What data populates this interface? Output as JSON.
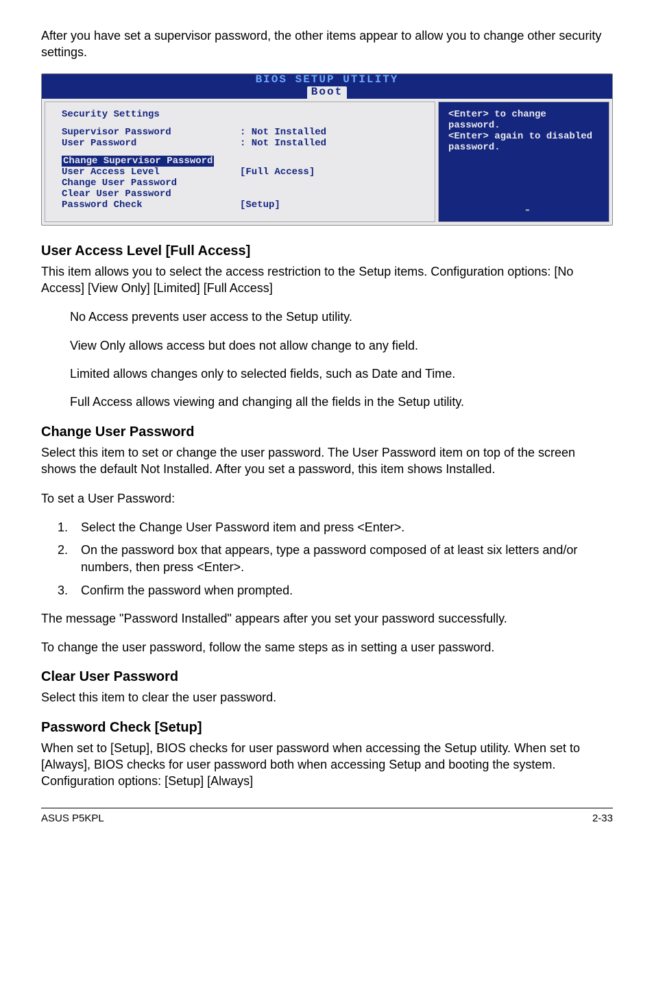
{
  "intro_paragraph": "After you have set a supervisor password, the other items appear to allow you to change other security settings.",
  "bios": {
    "title_top": "BIOS SETUP UTILITY",
    "tab": "Boot",
    "heading": "Security Settings",
    "rows": {
      "supervisor_label": "Supervisor Password",
      "supervisor_value": ": Not Installed",
      "user_label": "User Password",
      "user_value": ": Not Installed",
      "change_supervisor": "Change Supervisor Password",
      "user_access_label": "User Access Level",
      "user_access_value": "[Full Access]",
      "change_user": "Change User Password",
      "clear_user": "Clear User Password",
      "password_check_label": "Password Check",
      "password_check_value": "[Setup]"
    },
    "help_line1": "<Enter> to change password.",
    "help_line2": "<Enter> again to disabled password.",
    "slash": "-"
  },
  "sections": {
    "user_access": {
      "title": "User Access Level [Full Access]",
      "p1": "This item allows you to select the access restriction to the Setup items. Configuration options: [No Access] [View Only] [Limited] [Full Access]",
      "b1": "No Access prevents user access to the Setup utility.",
      "b2": "View Only allows access but does not allow change to any field.",
      "b3": "Limited allows changes only to selected fields, such as Date and Time.",
      "b4": "Full Access allows viewing and changing all the fields in the Setup utility."
    },
    "change_user": {
      "title": "Change User Password",
      "p1": "Select this item to set or change the user password. The User Password item on top of the screen shows the default Not Installed. After you set a password, this item shows Installed.",
      "p2": "To set a User Password:",
      "step1": "Select the Change User Password item and press <Enter>.",
      "step2": "On the password box that appears, type a password composed of at least six letters and/or numbers, then press <Enter>.",
      "step3": "Confirm the password when prompted.",
      "p3": "The message \"Password Installed\" appears after you set your password successfully.",
      "p4": "To change the user password, follow the same steps as in setting a user password."
    },
    "clear_user": {
      "title": "Clear User Password",
      "p1": "Select this item to clear the user password."
    },
    "password_check": {
      "title": "Password Check [Setup]",
      "p1": "When set to [Setup], BIOS checks for user password when accessing the Setup utility. When set to [Always], BIOS checks for user password both when accessing Setup and booting the system. Configuration options: [Setup] [Always]"
    }
  },
  "footer": {
    "left": "ASUS P5KPL",
    "right": "2-33"
  },
  "chart_data": {
    "type": "table",
    "title": "BIOS SETUP UTILITY — Boot > Security Settings",
    "rows": [
      {
        "item": "Supervisor Password",
        "value": "Not Installed"
      },
      {
        "item": "User Password",
        "value": "Not Installed"
      },
      {
        "item": "Change Supervisor Password",
        "value": ""
      },
      {
        "item": "User Access Level",
        "value": "[Full Access]"
      },
      {
        "item": "Change User Password",
        "value": ""
      },
      {
        "item": "Clear User Password",
        "value": ""
      },
      {
        "item": "Password Check",
        "value": "[Setup]"
      }
    ],
    "help": "<Enter> to change password. <Enter> again to disabled password."
  }
}
